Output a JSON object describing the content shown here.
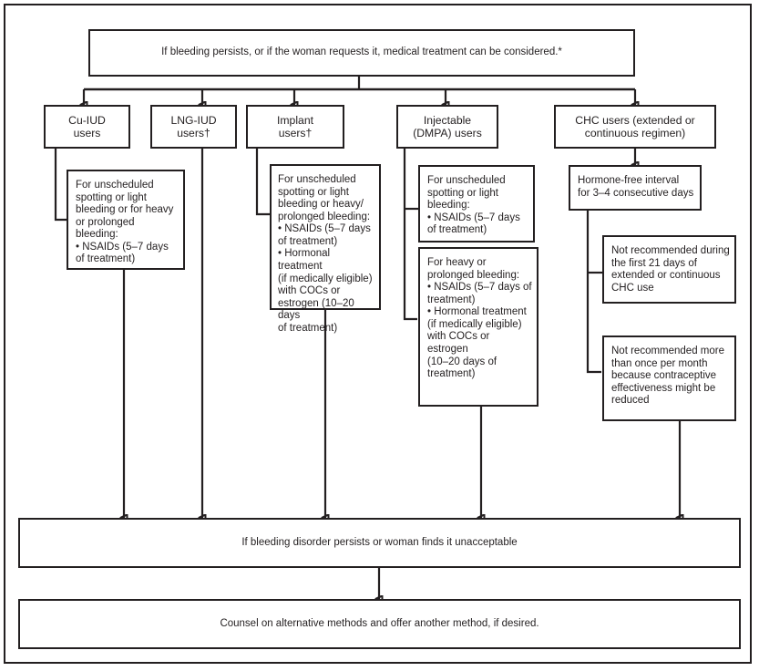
{
  "diagram": {
    "title_box": {
      "text": "If bleeding persists, or if the woman requests it, medical treatment can be considered.*"
    },
    "method_boxes": [
      {
        "id": "cu-iud",
        "label": "Cu-IUD\nusers"
      },
      {
        "id": "lng-iud",
        "label": "LNG-IUD\nusers†"
      },
      {
        "id": "implant",
        "label": "Implant\nusers†"
      },
      {
        "id": "injectable",
        "label": "Injectable\n(DMPA) users"
      },
      {
        "id": "chc",
        "label": "CHC users (extended or\ncontinuous regimen)"
      }
    ],
    "detail_boxes": [
      {
        "id": "cu-iud-detail",
        "text": "For unscheduled\nspotting or light\nbleeding or for heavy\nor prolonged bleeding:\n• NSAIDs  (5–7 days\nof treatment)"
      },
      {
        "id": "implant-detail",
        "text": "For unscheduled\nspotting or light\nbleeding or heavy/\nprolonged bleeding:\n• NSAIDs (5–7 days\nof treatment)\n• Hormonal treatment\n(if medically eligible)\nwith COCs or\nestrogen (10–20 days\n of treatment)"
      },
      {
        "id": "injectable-detail-1",
        "text": "For unscheduled\n spotting or light\nbleeding:\n• NSAIDs (5–7 days\nof treatment)"
      },
      {
        "id": "injectable-detail-2",
        "text": "For heavy or\nprolonged bleeding:\n• NSAIDs (5–7 days of\ntreatment)\n• Hormonal treatment\n(if medically eligible)\nwith COCs or estrogen\n(10–20 days of\ntreatment)"
      },
      {
        "id": "chc-hormone-free",
        "text": "Hormone-free interval\n for 3–4 consecutive days"
      },
      {
        "id": "chc-note-1",
        "text": "Not recommended during\nthe first 21 days of\nextended or continuous\nCHC use"
      },
      {
        "id": "chc-note-2",
        "text": "Not recommended more\nthan once per month\nbecause contraceptive\neffectiveness might be\nreduced"
      }
    ],
    "outcome_boxes": [
      {
        "id": "persists",
        "text": "If bleeding disorder persists or woman finds it unacceptable"
      },
      {
        "id": "counsel",
        "text": "Counsel on alternative methods and offer another method, if desired."
      }
    ],
    "colors": {
      "line": "#231f20",
      "background": "#ffffff",
      "text": "#231f20"
    }
  }
}
